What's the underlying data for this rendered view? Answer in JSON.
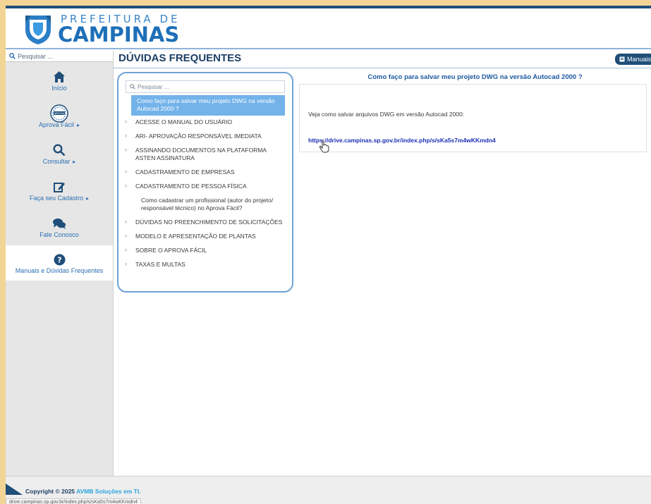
{
  "logo": {
    "top_text": "PREFEITURA DE",
    "bottom_text": "CAMPINAS"
  },
  "sidebar": {
    "search_placeholder": "Pesquisar ...",
    "items": [
      {
        "label": "Início",
        "icon": "home-icon",
        "has_caret": false
      },
      {
        "label": "Aprova Fácil",
        "icon": "aprova-facil-badge-icon",
        "has_caret": true
      },
      {
        "label": "Consultar",
        "icon": "search-icon",
        "has_caret": true
      },
      {
        "label": "Faça seu Cadastro",
        "icon": "edit-icon",
        "has_caret": true
      },
      {
        "label": "Fale Conosco",
        "icon": "chat-icon",
        "has_caret": false
      },
      {
        "label": "Manuais e Dúvidas Frequentes",
        "icon": "question-icon",
        "has_caret": false,
        "active": true
      }
    ]
  },
  "main": {
    "title": "DÚVIDAS FREQUENTES",
    "manual_button": "Manuais"
  },
  "faq": {
    "search_placeholder": "Pesquisar ...",
    "selected": "Como faço para salvar meu projeto DWG na versão Autocad 2000 ?",
    "items": [
      {
        "label": "ACESSE O MANUAL DO USUÁRIO",
        "bullet": true
      },
      {
        "label": "ARI- APROVAÇÃO RESPONSÁVEL IMEDIATA",
        "bullet": true
      },
      {
        "label": "ASSINANDO DOCUMENTOS NA PLATAFORMA ASTEN ASSINATURA",
        "bullet": true
      },
      {
        "label": "CADASTRAMENTO DE EMPRESAS",
        "bullet": true
      },
      {
        "label": "CADASTRAMENTO DE PESSOA FÍSICA",
        "bullet": true
      },
      {
        "label": "Como cadastrar um profissional (autor do projeto/ responsável técnico) no Aprova Fácil?",
        "bullet": false
      },
      {
        "label": "DÚVIDAS NO PREENCHIMENTO DE SOLICITAÇÕES",
        "bullet": true
      },
      {
        "label": "MODELO E APRESENTAÇÃO DE PLANTAS",
        "bullet": true
      },
      {
        "label": "SOBRE O APROVA FÁCIL",
        "bullet": true
      },
      {
        "label": "TAXAS E MULTAS",
        "bullet": true
      }
    ]
  },
  "answer": {
    "title": "Como faço para salvar meu projeto DWG na versão Autocad 2000 ?",
    "text": "Veja como salvar arquivos DWG em versão Autocad 2000:",
    "link": "https://drive.campinas.sp.gov.br/index.php/s/sKa5s7m4wKKmdn4"
  },
  "footer": {
    "copyright": "Copyright © 2025",
    "brand": "AVMB Soluções em TI."
  },
  "statusbar": {
    "url": "drive.campinas.sp.gov.br/index.php/s/sKa5s7m4wKKmdn4"
  },
  "colors": {
    "page_bg": "#f2d594",
    "primary": "#1f4e79",
    "accent": "#2a6fb1",
    "selected": "#74b3ea",
    "link": "#1b2fb5"
  }
}
